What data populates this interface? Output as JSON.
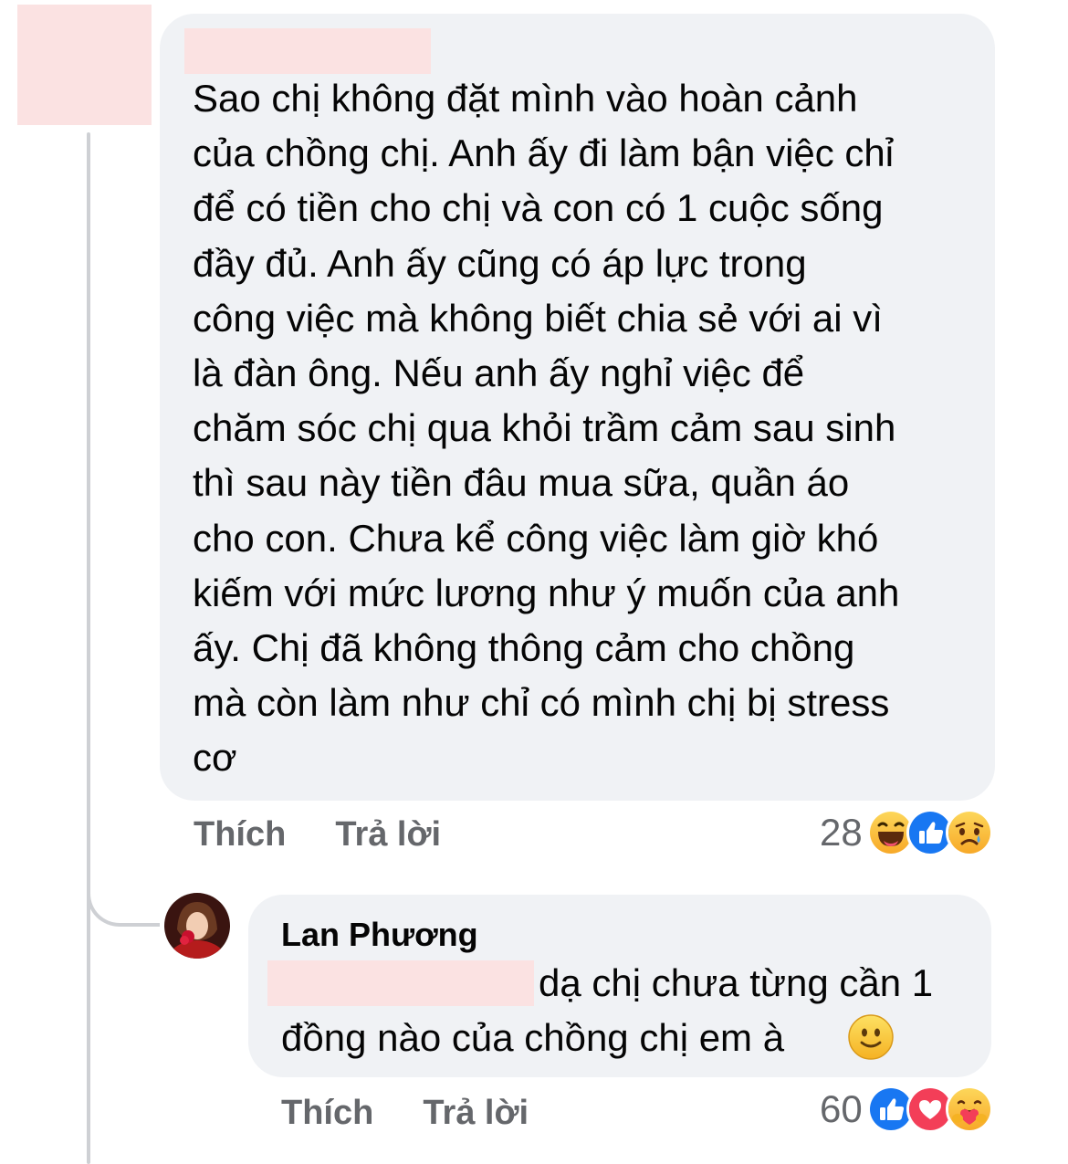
{
  "comment": {
    "text": "Sao chị không đặt mình vào hoàn cảnh\ncủa chồng chị. Anh ấy đi làm bận việc chỉ\nđể có tiền cho chị và con có 1 cuộc sống\nđầy đủ. Anh ấy cũng có áp lực trong\ncông việc mà không biết chia sẻ với ai vì\nlà đàn ông. Nếu anh ấy nghỉ việc để\nchăm sóc chị qua khỏi trầm cảm sau sinh\nthì sau này tiền đâu mua sữa, quần áo\ncho con. Chưa kể công việc làm giờ khó\nkiếm với mức lương như ý muốn của anh\nấy. Chị đã không thông cảm cho chồng\nmà còn làm như chỉ có mình chị bị stress\ncơ",
    "like_label": "Thích",
    "reply_label": "Trả lời",
    "reaction_count": "28",
    "reactions": [
      "haha-icon",
      "like-icon",
      "sad-icon"
    ]
  },
  "reply": {
    "author": "Lan Phương",
    "line1": "dạ chị chưa từng cần 1",
    "line2": "đồng nào của chồng chị em à",
    "emoji": "slight-smile-emoji",
    "like_label": "Thích",
    "reply_label": "Trả lời",
    "reaction_count": "60",
    "reactions": [
      "like-icon",
      "love-icon",
      "care-icon"
    ]
  },
  "colors": {
    "bubble": "#f0f2f5",
    "redaction": "#fbe2e2",
    "secondary_text": "#65676b",
    "like_blue": "#1877f2",
    "love_red": "#f33e58",
    "emoji_yellow": "#f7b125"
  }
}
